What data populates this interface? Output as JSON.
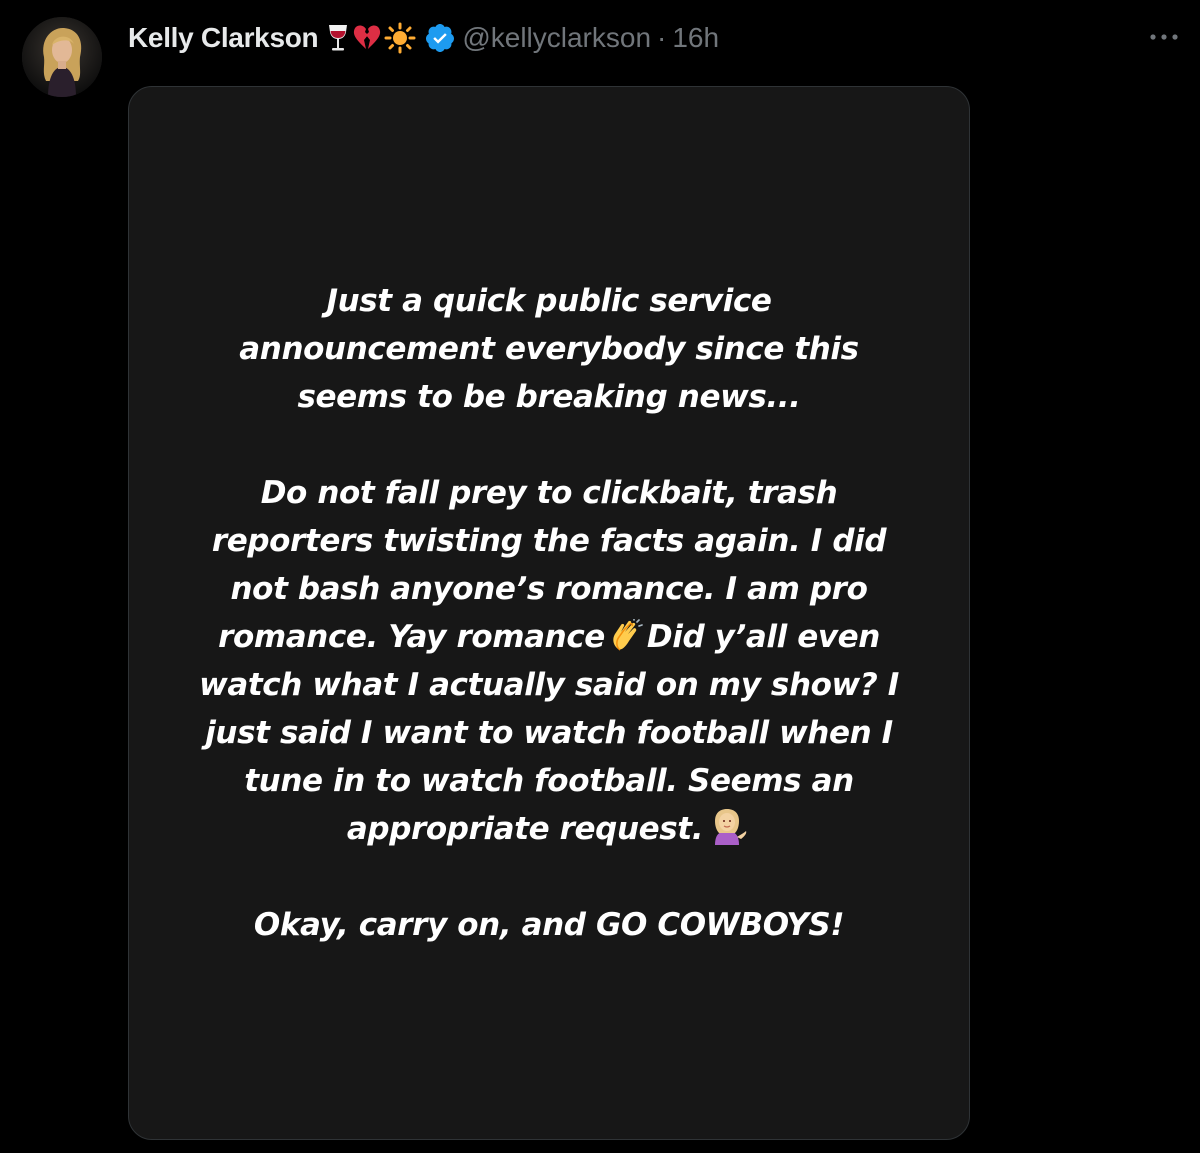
{
  "tweet": {
    "display_name": "Kelly Clarkson",
    "name_emoji": [
      "wine-glass-icon",
      "broken-heart-icon",
      "sun-icon"
    ],
    "verified": true,
    "handle": "@kellyclarkson",
    "separator": "·",
    "time": "16h",
    "colors": {
      "background": "#000000",
      "name": "#e7e9ea",
      "secondary": "#71767b",
      "verified_badge": "#1d9bf0",
      "media_background": "#171717",
      "story_text": "#ffffff"
    }
  },
  "story": {
    "paragraph_1": [
      "Just a quick public service",
      "announcement everybody since this",
      "seems to be breaking news..."
    ],
    "paragraph_2": {
      "line_1": "Do not fall prey to clickbait, trash",
      "line_2": "reporters twisting the facts again. I did",
      "line_3": "not bash anyone’s romance. I am pro",
      "line_4_before": "romance. Yay romance",
      "line_4_emoji": "clapping-hands-icon",
      "line_4_after": "Did y’all even",
      "line_5": "watch what I actually said on my show? I",
      "line_6": "just said I want to watch football when I",
      "line_7": "tune in to watch football. Seems an",
      "line_8_before": "appropriate request.",
      "line_8_emoji": "person-tipping-hand-icon"
    },
    "paragraph_3": [
      "Okay, carry on, and GO COWBOYS!"
    ]
  }
}
